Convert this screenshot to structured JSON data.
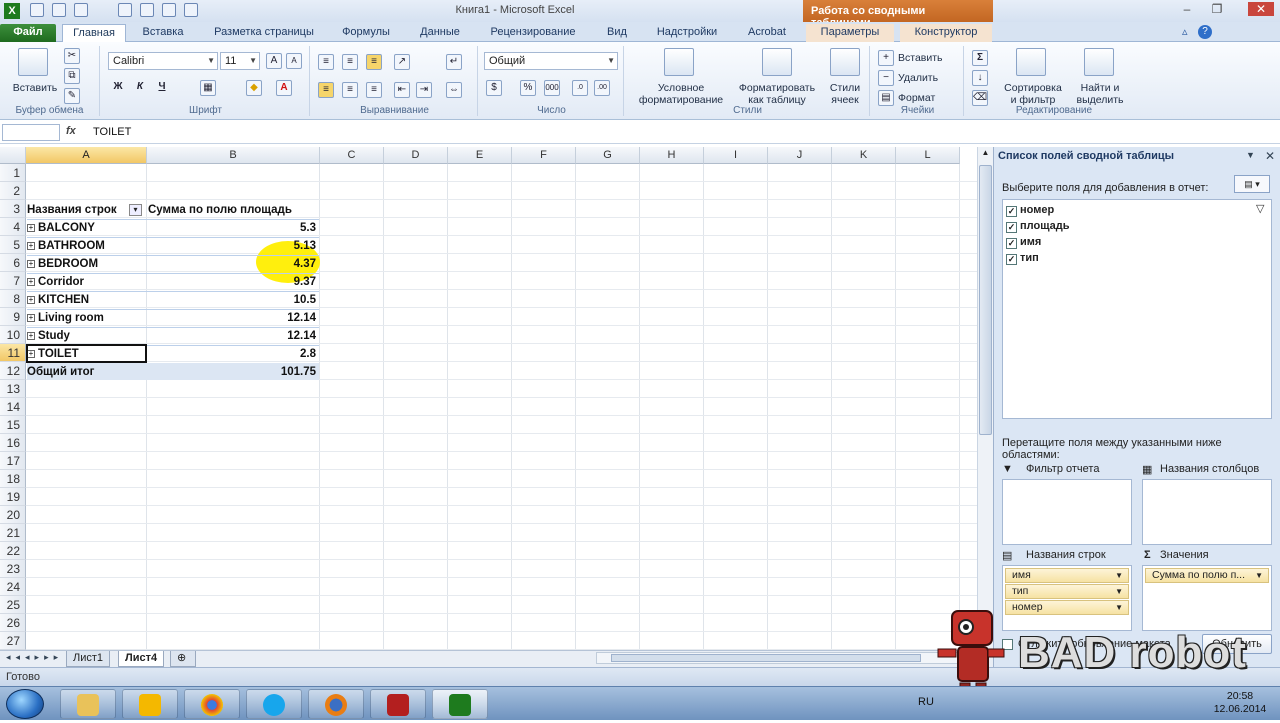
{
  "window": {
    "title": "Книга1 - Microsoft Excel",
    "context_tab": "Работа со сводными таблицами"
  },
  "tabs": [
    "Файл",
    "Главная",
    "Вставка",
    "Разметка страницы",
    "Формулы",
    "Данные",
    "Рецензирование",
    "Вид",
    "Надстройки",
    "Acrobat",
    "Параметры",
    "Конструктор"
  ],
  "ribbon": {
    "clipboard": {
      "paste": "Вставить",
      "label": "Буфер обмена"
    },
    "font": {
      "name": "Calibri",
      "size": "11",
      "label": "Шрифт",
      "bold": "Ж",
      "italic": "К",
      "underline": "Ч"
    },
    "align": {
      "label": "Выравнивание"
    },
    "number": {
      "format": "Общий",
      "label": "Число"
    },
    "styles": {
      "cond": "Условное форматирование",
      "table": "Форматировать как таблицу",
      "cell": "Стили ячеек",
      "label": "Стили"
    },
    "cells": {
      "insert": "Вставить",
      "delete": "Удалить",
      "format": "Формат",
      "label": "Ячейки"
    },
    "editing": {
      "sort": "Сортировка и фильтр",
      "find": "Найти и выделить",
      "label": "Редактирование"
    }
  },
  "formula_bar": {
    "fx": "fx",
    "value": "TOILET"
  },
  "columns": [
    "A",
    "B",
    "C",
    "D",
    "E",
    "F",
    "G",
    "H",
    "I",
    "J",
    "K",
    "L"
  ],
  "rows": [
    "1",
    "2",
    "3",
    "4",
    "5",
    "6",
    "7",
    "8",
    "9",
    "10",
    "11",
    "12",
    "13",
    "14",
    "15",
    "16",
    "17",
    "18",
    "19",
    "20",
    "21",
    "22",
    "23",
    "24",
    "25",
    "26",
    "27"
  ],
  "pivot": {
    "header_rows": "Названия строк",
    "header_values": "Сумма по полю площадь",
    "items": [
      {
        "name": "BALCONY",
        "value": "5.3"
      },
      {
        "name": "BATHROOM",
        "value": "5.13"
      },
      {
        "name": "BEDROOM",
        "value": "4.37"
      },
      {
        "name": "Corridor",
        "value": "9.37"
      },
      {
        "name": "KITCHEN",
        "value": "10.5"
      },
      {
        "name": "Living room",
        "value": "12.14"
      },
      {
        "name": "Study",
        "value": "12.14"
      },
      {
        "name": "TOILET",
        "value": "2.8"
      }
    ],
    "total_label": "Общий итог",
    "total_value": "101.75"
  },
  "sheets": [
    "Лист1",
    "Лист4"
  ],
  "status": "Готово",
  "field_pane": {
    "title": "Список полей сводной таблицы",
    "subtitle": "Выберите поля для добавления в отчет:",
    "fields": [
      "номер",
      "площадь",
      "имя",
      "тип"
    ],
    "drag_hint": "Перетащите поля между указанными ниже областями:",
    "filter_area": "Фильтр отчета",
    "columns_area": "Названия столбцов",
    "rows_area": "Названия строк",
    "values_area": "Значения",
    "row_fields": [
      "имя",
      "тип",
      "номер"
    ],
    "value_fields": [
      "Сумма по полю п..."
    ],
    "defer_label": "Отложить обновление макета",
    "update_button": "Обновить"
  },
  "taskbar": {
    "lang": "RU",
    "time": "20:58",
    "date": "12.06.2014"
  },
  "watermark": "BAD robot"
}
